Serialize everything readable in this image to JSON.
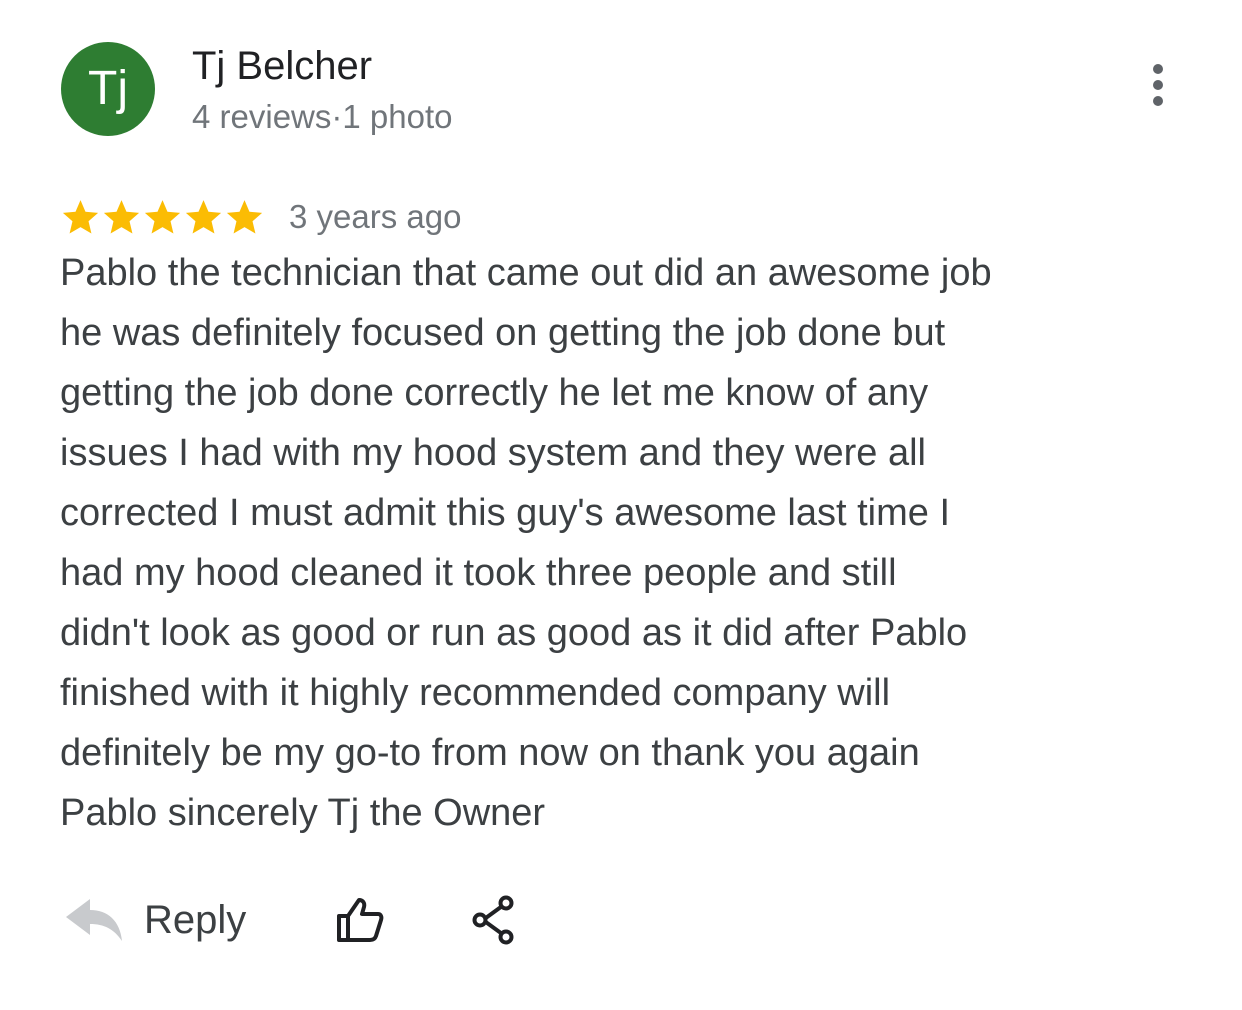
{
  "author": {
    "initials": "Tj",
    "name": "Tj Belcher",
    "meta": "4 reviews·1 photo",
    "avatar_color": "#2e7d32"
  },
  "menu": {
    "icon": "more-vert-icon"
  },
  "review": {
    "rating": 5,
    "max_rating": 5,
    "star_color": "#fbbc04",
    "date": "3 years ago",
    "text_lines": [
      "Pablo the technician that came out did an awesome job",
      "he was definitely focused on getting the job done but",
      "getting the job done correctly he let me know of any",
      "issues I had with my hood system and they were all",
      "corrected I must admit this guy's awesome last time I",
      "had my hood cleaned it took three people and still",
      "didn't look as good or run as good as it did after Pablo",
      "finished with it highly recommended company will",
      "definitely be my go-to from now on thank you again",
      "Pablo sincerely Tj the Owner"
    ]
  },
  "actions": {
    "reply_label": "Reply",
    "reply_icon": "reply-arrow-icon",
    "like_icon": "thumbs-up-icon",
    "share_icon": "share-icon"
  }
}
